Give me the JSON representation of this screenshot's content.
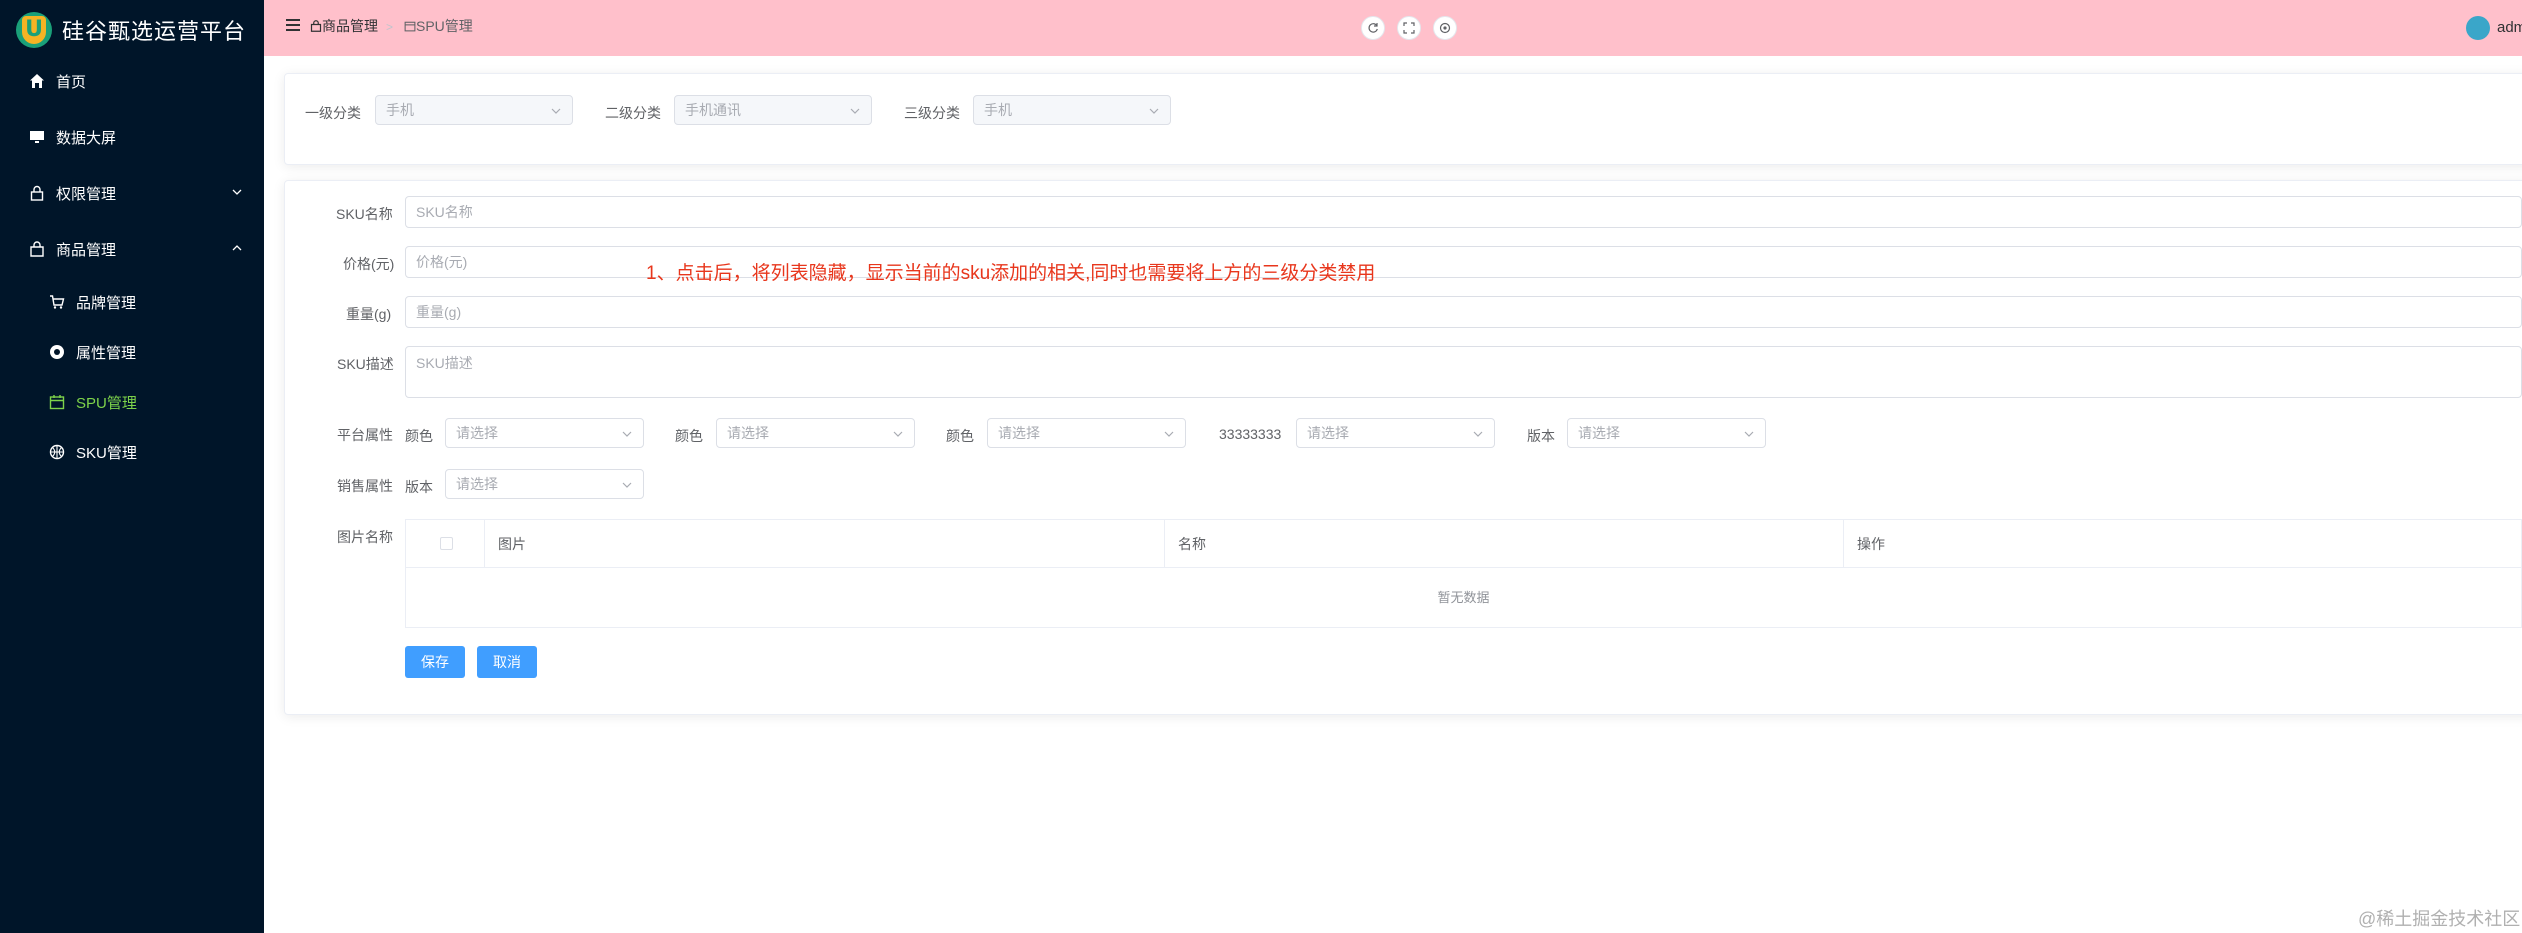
{
  "app": {
    "title": "硅谷甄选运营平台",
    "logo_letter": "U"
  },
  "sidebar": {
    "items": [
      {
        "label": "首页",
        "icon": "home-icon"
      },
      {
        "label": "数据大屏",
        "icon": "monitor-icon"
      },
      {
        "label": "权限管理",
        "icon": "lock-icon"
      },
      {
        "label": "商品管理",
        "icon": "shop-icon"
      },
      {
        "label": "品牌管理",
        "icon": "cart-icon"
      },
      {
        "label": "属性管理",
        "icon": "chrome-icon"
      },
      {
        "label": "SPU管理",
        "icon": "calendar-icon"
      },
      {
        "label": "SKU管理",
        "icon": "basketball-icon"
      }
    ],
    "active": "SPU管理"
  },
  "header": {
    "breadcrumb": [
      "商品管理",
      "SPU管理"
    ],
    "username": "adm"
  },
  "category": {
    "c1_label": "一级分类",
    "c1_value": "手机",
    "c2_label": "二级分类",
    "c2_value": "手机通讯",
    "c3_label": "三级分类",
    "c3_value": "手机"
  },
  "form": {
    "name_label": "SKU名称",
    "name_placeholder": "SKU名称",
    "price_label": "价格(元)",
    "price_placeholder": "价格(元)",
    "weight_label": "重量(g)",
    "weight_placeholder": "重量(g)",
    "desc_label": "SKU描述",
    "desc_placeholder": "SKU描述",
    "platform_label": "平台属性",
    "platform_attrs": [
      {
        "name": "颜色",
        "placeholder": "请选择"
      },
      {
        "name": "颜色",
        "placeholder": "请选择"
      },
      {
        "name": "颜色",
        "placeholder": "请选择"
      },
      {
        "name": "33333333",
        "placeholder": "请选择"
      },
      {
        "name": "版本",
        "placeholder": "请选择"
      }
    ],
    "sale_label": "销售属性",
    "sale_attrs": [
      {
        "name": "版本",
        "placeholder": "请选择"
      }
    ],
    "image_label": "图片名称",
    "table": {
      "columns": [
        "图片",
        "名称",
        "操作"
      ],
      "empty_text": "暂无数据"
    },
    "save_label": "保存",
    "cancel_label": "取消"
  },
  "annotation": "1、点击后，将列表隐藏，显示当前的sku添加的相关,同时也需要将上方的三级分类禁用",
  "watermark": "@稀土掘金技术社区",
  "colors": {
    "sidebar_bg": "#001529",
    "topbar_bg": "#ffc0cb",
    "active_menu": "#7dd34a",
    "primary": "#409eff",
    "annotation": "#e8361c"
  }
}
